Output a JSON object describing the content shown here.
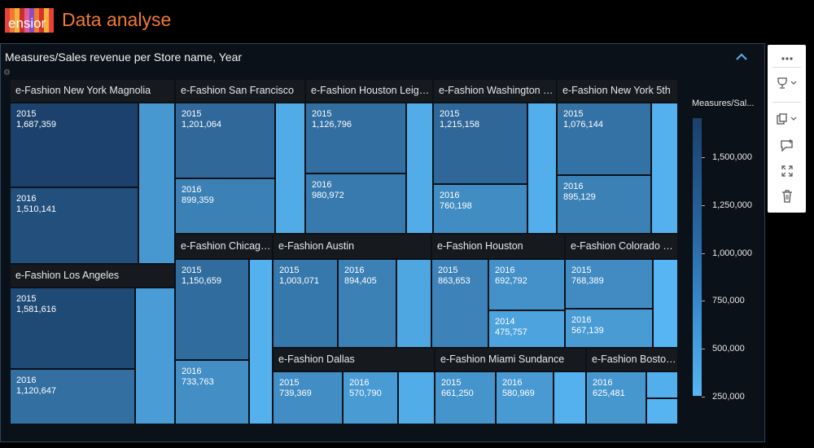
{
  "app": {
    "logo_text": "ensior",
    "title": "Data analyse"
  },
  "panel": {
    "title": "Measures/Sales revenue per Store name, Year"
  },
  "colors": {
    "accent": "#f07a32",
    "scale_high": "#1b406b",
    "scale_low": "#56b5f2",
    "header_bg": "#161a1f",
    "logo_stripes": [
      "#e8413a",
      "#f07a32",
      "#f6b33c",
      "#c9302c",
      "#e05b9a",
      "#8a4fbf",
      "#f07a32",
      "#d6322a",
      "#f6b33c",
      "#e8413a"
    ]
  },
  "toolbar": {
    "icons": [
      "more-icon",
      "trophy-icon",
      "copy-icon",
      "comment-icon",
      "expand-icon",
      "trash-icon"
    ]
  },
  "chart_data": {
    "type": "treemap",
    "measure": "Measures/Sales revenue",
    "legend_title": "Measures/Sal...",
    "color_scale": {
      "min": 250000,
      "max": 1700000,
      "ticks": [
        "1,500,000",
        "1,250,000",
        "1,000,000",
        "750,000",
        "500,000",
        "250,000"
      ],
      "tick_values": [
        1500000,
        1250000,
        1000000,
        750000,
        500000,
        250000
      ]
    },
    "stores": [
      {
        "name": "e-Fashion New York Magnolia",
        "label": "e-Fashion New York Magnolia",
        "values": [
          {
            "year": "2015",
            "value": 1687359,
            "text": "1,687,359"
          },
          {
            "year": "2016",
            "value": 1510141,
            "text": "1,510,141"
          },
          {
            "year": "",
            "value": 620000,
            "text": ""
          }
        ]
      },
      {
        "name": "e-Fashion Los Angeles",
        "label": "e-Fashion Los Angeles",
        "values": [
          {
            "year": "2015",
            "value": 1581616,
            "text": "1,581,616"
          },
          {
            "year": "2016",
            "value": 1120647,
            "text": "1,120,647"
          },
          {
            "year": "",
            "value": 560000,
            "text": ""
          }
        ]
      },
      {
        "name": "e-Fashion San Francisco",
        "label": "e-Fashion San Francisco",
        "values": [
          {
            "year": "2015",
            "value": 1201064,
            "text": "1,201,064"
          },
          {
            "year": "2016",
            "value": 899359,
            "text": "899,359"
          },
          {
            "year": "",
            "value": 380000,
            "text": ""
          }
        ]
      },
      {
        "name": "e-Fashion Houston Leighton",
        "label": "e-Fashion Houston Leight...",
        "values": [
          {
            "year": "2015",
            "value": 1126796,
            "text": "1,126,796"
          },
          {
            "year": "2016",
            "value": 980972,
            "text": "980,972"
          },
          {
            "year": "",
            "value": 360000,
            "text": ""
          }
        ]
      },
      {
        "name": "e-Fashion Washington Tower",
        "label": "e-Fashion Washington To...",
        "values": [
          {
            "year": "2015",
            "value": 1215158,
            "text": "1,215,158"
          },
          {
            "year": "2016",
            "value": 760198,
            "text": "760,198"
          },
          {
            "year": "",
            "value": 330000,
            "text": ""
          }
        ]
      },
      {
        "name": "e-Fashion New York 5th",
        "label": "e-Fashion New York 5th",
        "values": [
          {
            "year": "2015",
            "value": 1076144,
            "text": "1,076,144"
          },
          {
            "year": "2016",
            "value": 895129,
            "text": "895,129"
          },
          {
            "year": "",
            "value": 300000,
            "text": ""
          }
        ]
      },
      {
        "name": "e-Fashion Chicago",
        "label": "e-Fashion Chicago ...",
        "values": [
          {
            "year": "2015",
            "value": 1150659,
            "text": "1,150,659"
          },
          {
            "year": "2016",
            "value": 733763,
            "text": "733,763"
          },
          {
            "year": "",
            "value": 300000,
            "text": ""
          }
        ]
      },
      {
        "name": "e-Fashion Austin",
        "label": "e-Fashion Austin",
        "values": [
          {
            "year": "2015",
            "value": 1003071,
            "text": "1,003,071"
          },
          {
            "year": "2016",
            "value": 894405,
            "text": "894,405"
          },
          {
            "year": "",
            "value": 420000,
            "text": ""
          }
        ]
      },
      {
        "name": "e-Fashion Houston",
        "label": "e-Fashion Houston",
        "values": [
          {
            "year": "2015",
            "value": 863653,
            "text": "863,653"
          },
          {
            "year": "2016",
            "value": 692792,
            "text": "692,792"
          },
          {
            "year": "2014",
            "value": 475757,
            "text": "475,757"
          }
        ]
      },
      {
        "name": "e-Fashion Colorado Springs",
        "label": "e-Fashion Colorado Sp...",
        "values": [
          {
            "year": "2015",
            "value": 768389,
            "text": "768,389"
          },
          {
            "year": "2016",
            "value": 567139,
            "text": "567,139"
          },
          {
            "year": "",
            "value": 250000,
            "text": ""
          }
        ]
      },
      {
        "name": "e-Fashion Dallas",
        "label": "e-Fashion Dallas",
        "values": [
          {
            "year": "2015",
            "value": 739369,
            "text": "739,369"
          },
          {
            "year": "2016",
            "value": 570790,
            "text": "570,790"
          },
          {
            "year": "",
            "value": 360000,
            "text": ""
          }
        ]
      },
      {
        "name": "e-Fashion Miami Sundance",
        "label": "e-Fashion Miami Sundance",
        "values": [
          {
            "year": "2015",
            "value": 661250,
            "text": "661,250"
          },
          {
            "year": "2016",
            "value": 580969,
            "text": "580,969"
          },
          {
            "year": "",
            "value": 300000,
            "text": ""
          }
        ]
      },
      {
        "name": "e-Fashion Boston",
        "label": "e-Fashion Boston...",
        "values": [
          {
            "year": "2016",
            "value": 625481,
            "text": "625,481"
          },
          {
            "year": "",
            "value": 330000,
            "text": ""
          },
          {
            "year": "",
            "value": 260000,
            "text": ""
          }
        ]
      }
    ]
  }
}
